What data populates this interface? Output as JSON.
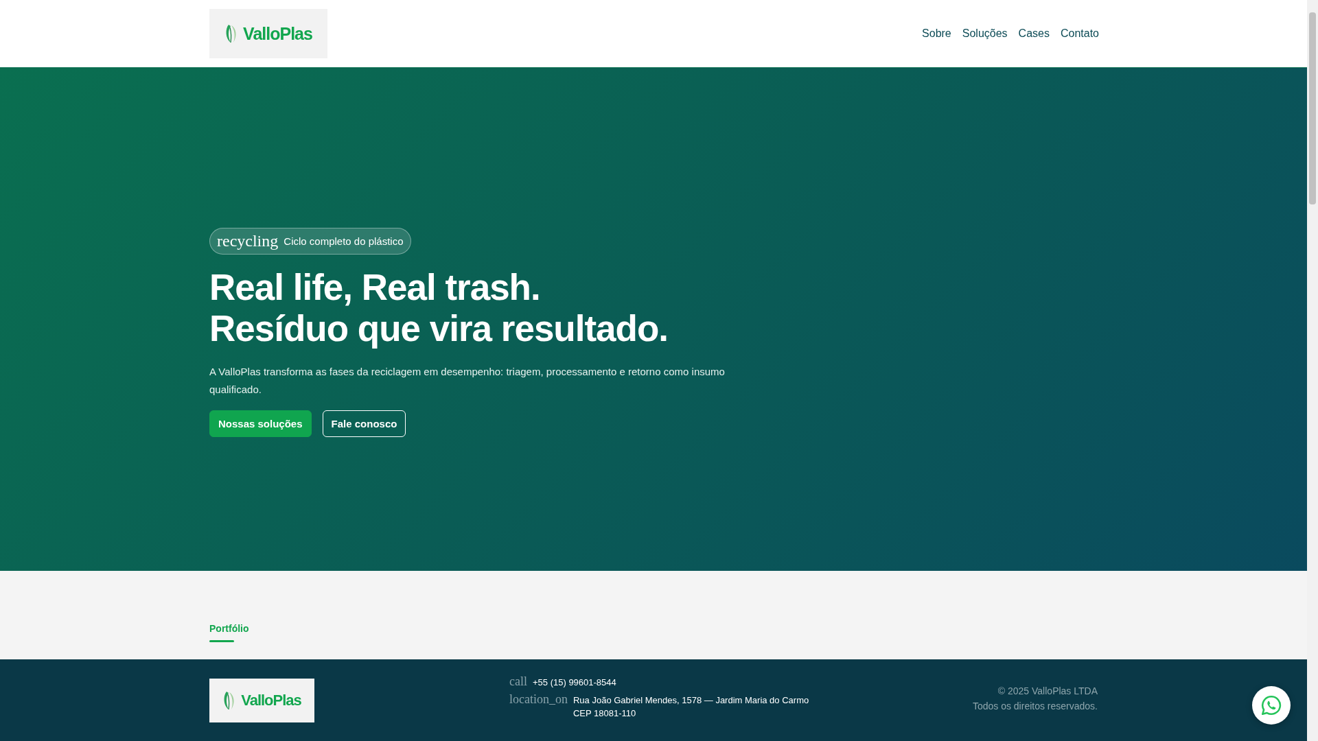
{
  "header": {
    "logo": {
      "text": "ValloPlas"
    },
    "nav": [
      {
        "label": "Sobre"
      },
      {
        "label": "Soluções"
      },
      {
        "label": "Cases"
      },
      {
        "label": "Contato"
      }
    ]
  },
  "hero": {
    "badge": {
      "icon_text": "recycling",
      "text": "Ciclo completo do plástico"
    },
    "headline": [
      "Real life, Real trash.",
      "Resíduo que vira resultado."
    ],
    "description": "A ValloPlas transforma as fases da reciclagem em desempenho: triagem, processamento e retorno como insumo qualificado.",
    "buttons": [
      {
        "label": "Nossas soluções",
        "kind": "primary"
      },
      {
        "label": "Fale conosco",
        "kind": "outline"
      }
    ]
  },
  "portfolio": {
    "eyebrow": "Portfólio"
  },
  "footer": {
    "logo": {
      "text": "ValloPlas"
    },
    "contacts": [
      {
        "icon_text": "call",
        "lines": [
          "+55 (15) 99601-8544"
        ]
      },
      {
        "icon_text": "location_on",
        "lines": [
          "Rua João Gabriel Mendes, 1578 — Jardim Maria do Carmo",
          "CEP 18081-110"
        ]
      }
    ],
    "copyright": [
      "© 2025 ValloPlas LTDA",
      "Todos os direitos reservados."
    ]
  }
}
